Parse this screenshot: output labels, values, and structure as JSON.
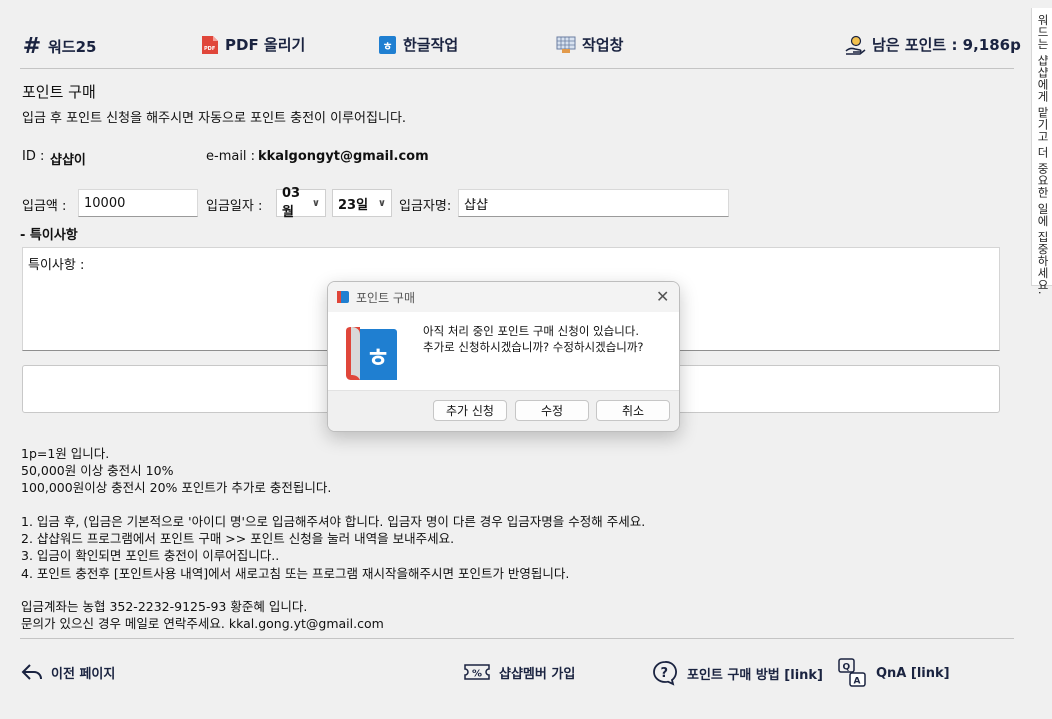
{
  "nav": {
    "brand": "워드25",
    "pdf": "PDF 올리기",
    "hangul": "한글작업",
    "workspace": "작업창",
    "points": "남은 포인트 : 9,186p"
  },
  "side_tab": "워드는 샵샵에게 맡기고 더 중요한 일에 집중하세요.",
  "form": {
    "title": "포인트 구매",
    "subtitle": "입금 후 포인트 신청을 해주시면 자동으로 포인트 충전이 이루어집니다.",
    "id_label": "ID :",
    "id_value": "샵샵이",
    "email_label": "e-mail :",
    "email_value": "kkalgongyt@gmail.com",
    "amount_label": "입금액 :",
    "amount_value": "10000",
    "date_label": "입금일자 :",
    "month_value": "03월",
    "day_value": "23일",
    "depositor_label": "입금자명:",
    "depositor_value": "샵샵",
    "notes_heading": "- 특이사항",
    "notes_value": "특이사항 :"
  },
  "info": {
    "lines1": [
      "1p=1원 입니다.",
      "50,000원 이상 충전시 10%",
      "100,000원이상 충전시 20% 포인트가 추가로 충전됩니다."
    ],
    "lines2": [
      "1. 입금 후, (입금은 기본적으로 '아이디 명'으로 입금해주셔야 합니다. 입금자 명이 다른 경우 입금자명을 수정해 주세요.",
      "2. 샵샵워드 프로그램에서 포인트 구매 >> 포인트 신청을 눌러 내역을 보내주세요.",
      "3. 입금이 확인되면 포인트 충전이 이루어집니다..",
      "4. 포인트 충전후 [포인트사용 내역]에서 새로고침 또는 프로그램 재시작을해주시면 포인트가 반영됩니다."
    ],
    "lines3": [
      "입금계좌는 농협 352-2232-9125-93 황준혜 입니다.",
      "문의가 있으신 경우 메일로 연락주세요. kkal.gong.yt@gmail.com"
    ]
  },
  "footer": {
    "back": "이전 페이지",
    "member": "샵샵멤버 가입",
    "howto": "포인트 구매 방법 [link]",
    "qna": "QnA [link]"
  },
  "dialog": {
    "title": "포인트 구매",
    "message1": "아직 처리 중인 포인트 구매 신청이 있습니다.",
    "message2": "추가로 신청하시겠습니까? 수정하시겠습니까?",
    "btn_add": "추가 신청",
    "btn_edit": "수정",
    "btn_cancel": "취소"
  },
  "colors": {
    "navy": "#1a2340",
    "pdf_red": "#e0463a",
    "hangul_blue": "#1f7fd1"
  }
}
